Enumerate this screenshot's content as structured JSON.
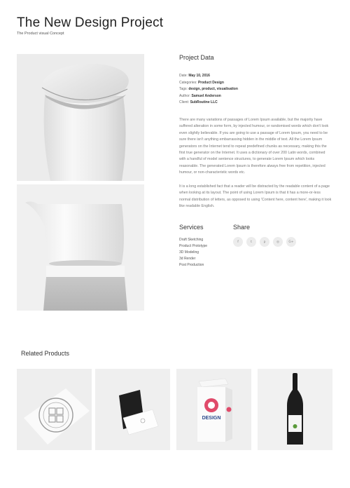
{
  "header": {
    "title": "The New Design Project",
    "subtitle": "The Product visual Concept"
  },
  "project": {
    "heading": "Project Data",
    "meta": [
      {
        "label": "Date:",
        "value": "May 10, 2016"
      },
      {
        "label": "Categories:",
        "value": "Product Design"
      },
      {
        "label": "Tags:",
        "value": "design, product, visualisation"
      },
      {
        "label": "Author:",
        "value": "Samuel Anderson"
      },
      {
        "label": "Client:",
        "value": "SubRoutine LLC"
      }
    ],
    "paragraph1": "There are many variations of passages of Lorem Ipsum available, but the majority have suffered alteration in some form, by injected humour, or randomised words which don't look even slightly believable. If you are going to use a passage of Lorem Ipsum, you need to be sure there isn't anything embarrassing hidden in the middle of text. All the Lorem Ipsum generators on the Internet tend to repeat predefined chunks as necessary, making this the first true generator on the Internet. It uses a dictionary of over 200 Latin words, combined with a handful of model sentence structures, to generate Lorem Ipsum which looks reasonable. The generated Lorem Ipsum is therefore always free from repetition, injected humour, or non-characteristic words etc.",
    "paragraph2": "It is a long established fact that a reader will be distracted by the readable content of a page when looking at its layout. The point of using Lorem Ipsum is that it has a more-or-less normal distribution of letters, as opposed to using 'Content here, content here', making it look like readable English."
  },
  "services": {
    "heading": "Services",
    "items": [
      "Draft Sketching",
      "Product Prototype",
      "3D Modeling",
      "3d Render",
      "Post Production"
    ]
  },
  "share": {
    "heading": "Share",
    "buttons": [
      {
        "icon": "facebook-icon",
        "glyph": "f"
      },
      {
        "icon": "twitter-icon",
        "glyph": "t"
      },
      {
        "icon": "pinterest-icon",
        "glyph": "p"
      },
      {
        "icon": "instagram-icon",
        "glyph": "◎"
      },
      {
        "icon": "google-plus-icon",
        "glyph": "G+"
      }
    ]
  },
  "related": {
    "heading": "Related Products",
    "products": [
      {
        "name": "stamp-seal-product"
      },
      {
        "name": "business-card-product"
      },
      {
        "name": "design-box-product",
        "box_text": "DESIGN"
      },
      {
        "name": "wine-bottle-product"
      }
    ]
  }
}
